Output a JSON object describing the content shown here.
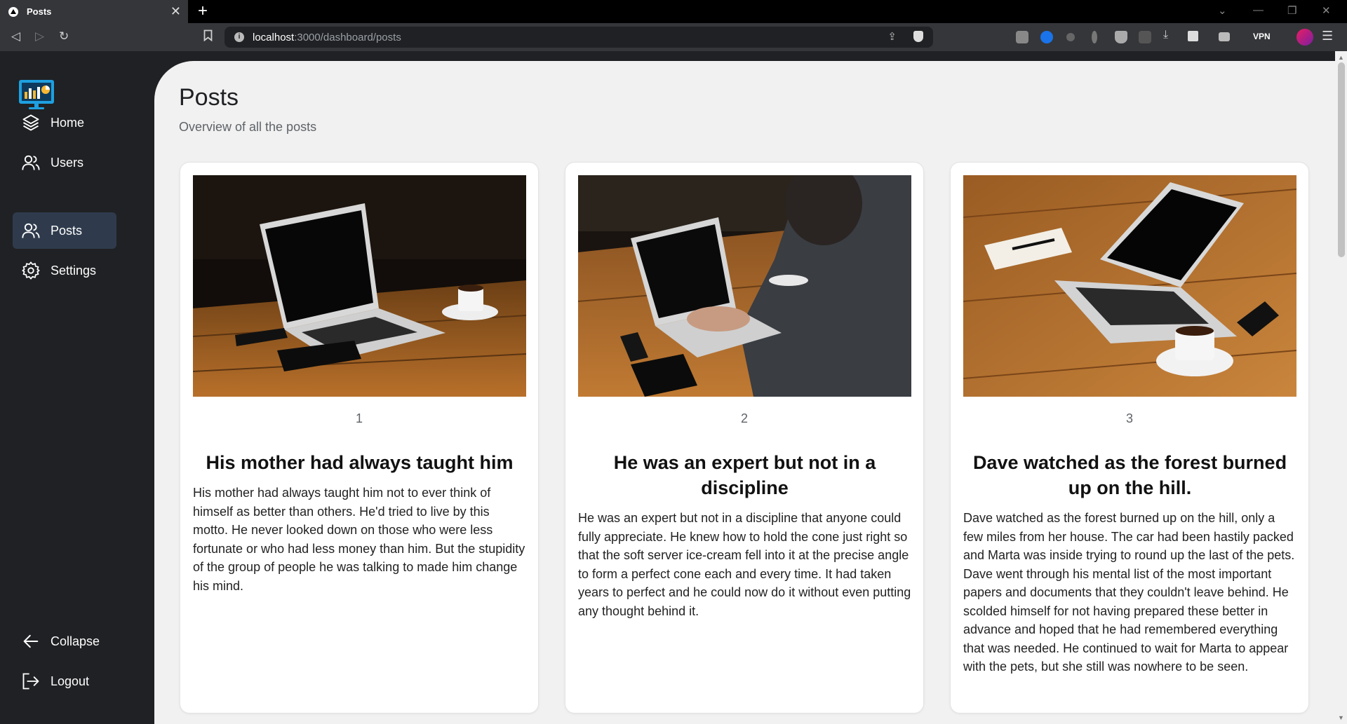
{
  "browser": {
    "tab_title": "Posts",
    "new_tab": "+",
    "url_host": "localhost",
    "url_path": ":3000/dashboard/posts",
    "vpn_label": "VPN"
  },
  "sidebar": {
    "items": [
      {
        "label": "Home",
        "icon": "layers-icon",
        "active": false
      },
      {
        "label": "Users",
        "icon": "users-icon",
        "active": false
      },
      {
        "label": "Posts",
        "icon": "users-icon",
        "active": true
      },
      {
        "label": "Settings",
        "icon": "gear-icon",
        "active": false
      }
    ],
    "collapse_label": "Collapse",
    "logout_label": "Logout"
  },
  "page": {
    "title": "Posts",
    "subtitle": "Overview of all the posts"
  },
  "posts": [
    {
      "number": "1",
      "title": "His mother had always taught him",
      "body": "His mother had always taught him not to ever think of himself as better than others. He'd tried to live by this motto. He never looked down on those who were less fortunate or who had less money than him. But the stupidity of the group of people he was talking to made him change his mind."
    },
    {
      "number": "2",
      "title": "He was an expert but not in a discipline",
      "body": "He was an expert but not in a discipline that anyone could fully appreciate. He knew how to hold the cone just right so that the soft server ice-cream fell into it at the precise angle to form a perfect cone each and every time. It had taken years to perfect and he could now do it without even putting any thought behind it."
    },
    {
      "number": "3",
      "title": "Dave watched as the forest burned up on the hill.",
      "body": "Dave watched as the forest burned up on the hill, only a few miles from her house. The car had been hastily packed and Marta was inside trying to round up the last of the pets. Dave went through his mental list of the most important papers and documents that they couldn't leave behind. He scolded himself for not having prepared these better in advance and hoped that he had remembered everything that was needed. He continued to wait for Marta to appear with the pets, but she still was nowhere to be seen."
    }
  ],
  "colors": {
    "sidebar_bg": "#202124",
    "active_item_bg": "#2f3b4d",
    "main_bg": "#f1f1f1"
  }
}
